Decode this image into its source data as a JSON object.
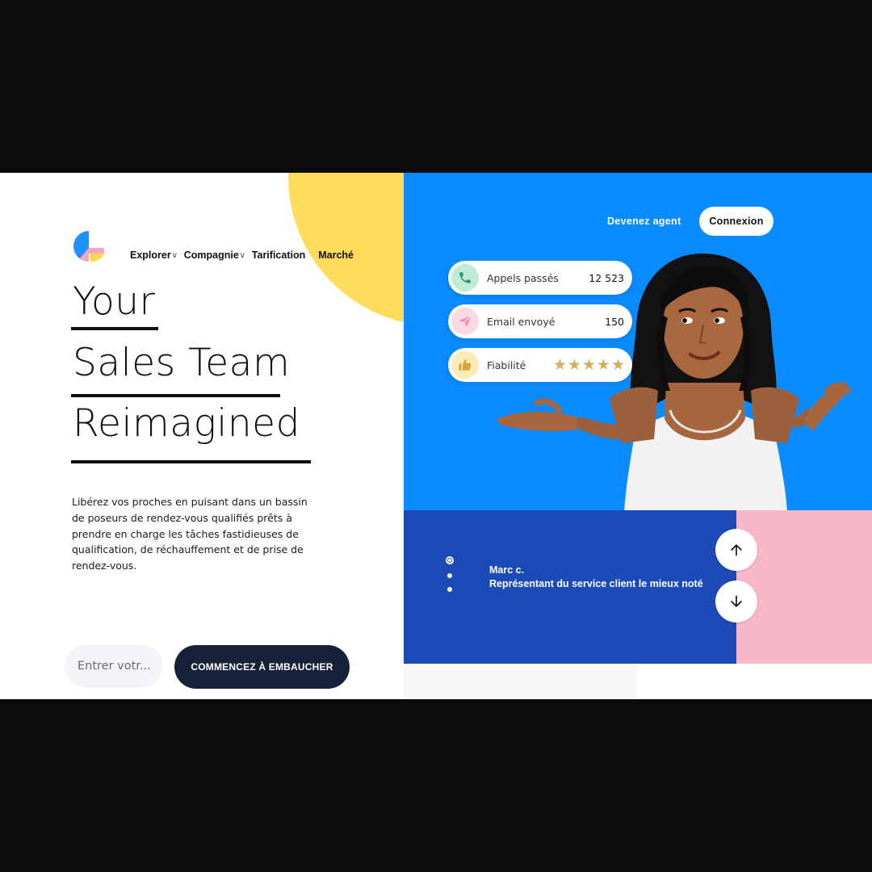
{
  "nav": {
    "items": [
      {
        "label": "Explorer",
        "chevron": "v"
      },
      {
        "label": "Compagnie",
        "chevron": "v"
      },
      {
        "label": "Tarification",
        "chevron": ""
      },
      {
        "label": "Marché",
        "chevron": ""
      }
    ]
  },
  "hero": {
    "line1": "Your",
    "line2": "Sales Team",
    "line3": "Reimagined",
    "description": "Libérez vos proches en puisant dans un bassin de poseurs de rendez-vous qualifiés prêts à prendre en charge les tâches fastidieuses de qualification, de réchauffement et de prise de rendez-vous."
  },
  "signup": {
    "placeholder": "Entrer votr...",
    "cta_label": "COMMENCEZ À EMBAUCHER"
  },
  "top_bar": {
    "agent_link": "Devenez agent",
    "login_label": "Connexion"
  },
  "stats": [
    {
      "icon": "phone-icon",
      "label": "Appels passés",
      "value": "12 523"
    },
    {
      "icon": "paper-plane-icon",
      "label": "Email envoyé",
      "value": "150"
    },
    {
      "icon": "thumbs-up-icon",
      "label": "Fiabilité",
      "rating": 5,
      "rating_max": 5,
      "stars_text": "★★★★★"
    }
  ],
  "review": {
    "name": "Marc c.",
    "role": "Représentant du service client le mieux noté",
    "slide_count": 3,
    "active_slide": 1
  },
  "colors": {
    "accent_blue": "#0A8BFF",
    "deep_blue": "#1C4BB8",
    "yellow": "#FFDC5C",
    "pink": "#F9B8C7",
    "dark_cta": "#18213A",
    "star_gold": "#D4AE5E"
  }
}
